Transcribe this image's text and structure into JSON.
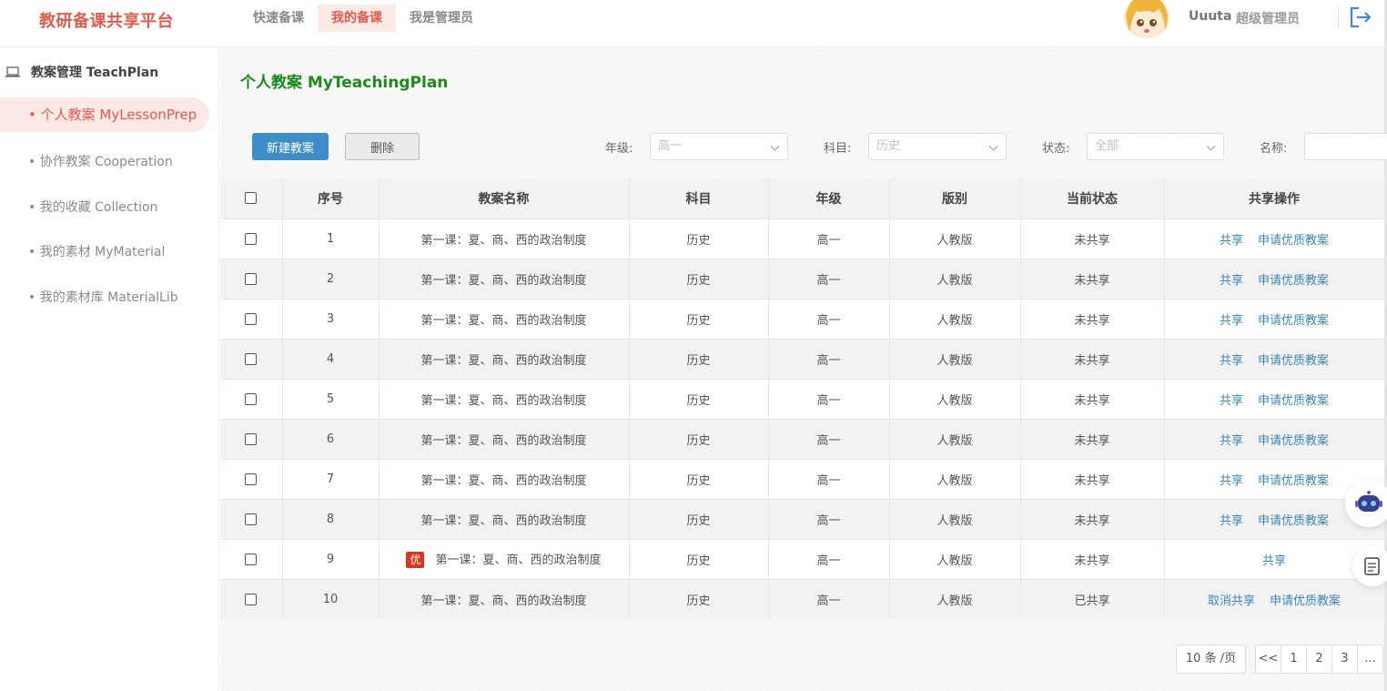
{
  "header": {
    "brand": "教研备课共享平台",
    "nav": [
      {
        "label": "快速备课",
        "active": false
      },
      {
        "label": "我的备课",
        "active": true
      },
      {
        "label": "我是管理员",
        "active": false
      }
    ],
    "user_name": "Uuuta",
    "user_role": "超级管理员"
  },
  "sidebar": {
    "group_label": "教案管理 TeachPlan",
    "items": [
      {
        "label": "• 个人教案 MyLessonPrep",
        "active": true
      },
      {
        "label": "• 协作教案 Cooperation",
        "active": false
      },
      {
        "label": "• 我的收藏 Collection",
        "active": false
      },
      {
        "label": "• 我的素材 MyMaterial",
        "active": false
      },
      {
        "label": "• 我的素材库 MaterialLib",
        "active": false
      }
    ]
  },
  "main": {
    "title": "个人教案 MyTeachingPlan",
    "new_button": "新建教案",
    "delete_button": "删除",
    "filters": {
      "grade_label": "年级:",
      "grade_value": "高一",
      "subject_label": "科目:",
      "subject_value": "历史",
      "status_label": "状态:",
      "status_value": "全部",
      "name_label": "名称:"
    },
    "table": {
      "headers": [
        "序号",
        "教案名称",
        "科目",
        "年级",
        "版别",
        "当前状态",
        "共享操作"
      ],
      "rows": [
        {
          "no": "1",
          "name": "第一课：夏、商、西的政治制度",
          "subject": "历史",
          "grade": "高一",
          "edition": "人教版",
          "status": "未共享",
          "badge": "",
          "ops": [
            "共享",
            "申请优质教案"
          ]
        },
        {
          "no": "2",
          "name": "第一课：夏、商、西的政治制度",
          "subject": "历史",
          "grade": "高一",
          "edition": "人教版",
          "status": "未共享",
          "badge": "",
          "ops": [
            "共享",
            "申请优质教案"
          ]
        },
        {
          "no": "3",
          "name": "第一课：夏、商、西的政治制度",
          "subject": "历史",
          "grade": "高一",
          "edition": "人教版",
          "status": "未共享",
          "badge": "",
          "ops": [
            "共享",
            "申请优质教案"
          ]
        },
        {
          "no": "4",
          "name": "第一课：夏、商、西的政治制度",
          "subject": "历史",
          "grade": "高一",
          "edition": "人教版",
          "status": "未共享",
          "badge": "",
          "ops": [
            "共享",
            "申请优质教案"
          ]
        },
        {
          "no": "5",
          "name": "第一课：夏、商、西的政治制度",
          "subject": "历史",
          "grade": "高一",
          "edition": "人教版",
          "status": "未共享",
          "badge": "",
          "ops": [
            "共享",
            "申请优质教案"
          ]
        },
        {
          "no": "6",
          "name": "第一课：夏、商、西的政治制度",
          "subject": "历史",
          "grade": "高一",
          "edition": "人教版",
          "status": "未共享",
          "badge": "",
          "ops": [
            "共享",
            "申请优质教案"
          ]
        },
        {
          "no": "7",
          "name": "第一课：夏、商、西的政治制度",
          "subject": "历史",
          "grade": "高一",
          "edition": "人教版",
          "status": "未共享",
          "badge": "",
          "ops": [
            "共享",
            "申请优质教案"
          ]
        },
        {
          "no": "8",
          "name": "第一课：夏、商、西的政治制度",
          "subject": "历史",
          "grade": "高一",
          "edition": "人教版",
          "status": "未共享",
          "badge": "",
          "ops": [
            "共享",
            "申请优质教案"
          ]
        },
        {
          "no": "9",
          "name": "第一课：夏、商、西的政治制度",
          "subject": "历史",
          "grade": "高一",
          "edition": "人教版",
          "status": "未共享",
          "badge": "优",
          "ops": [
            "共享"
          ]
        },
        {
          "no": "10",
          "name": "第一课：夏、商、西的政治制度",
          "subject": "历史",
          "grade": "高一",
          "edition": "人教版",
          "status": "已共享",
          "badge": "",
          "ops": [
            "取消共享",
            "申请优质教案"
          ]
        }
      ]
    },
    "pagination": {
      "page_size": "10 条 /页",
      "pages": [
        "<<",
        "1",
        "2",
        "3",
        "..."
      ]
    }
  },
  "colors": {
    "brand": "#e35b4a",
    "title_green": "#1e8a1e",
    "primary_button": "#3e8dc7",
    "link": "#3c86b8",
    "badge": "#d9381e"
  },
  "icons": [
    "laptop-icon",
    "logout-icon",
    "avatar",
    "robot-icon",
    "notes-icon",
    "chevron-down-icon"
  ]
}
